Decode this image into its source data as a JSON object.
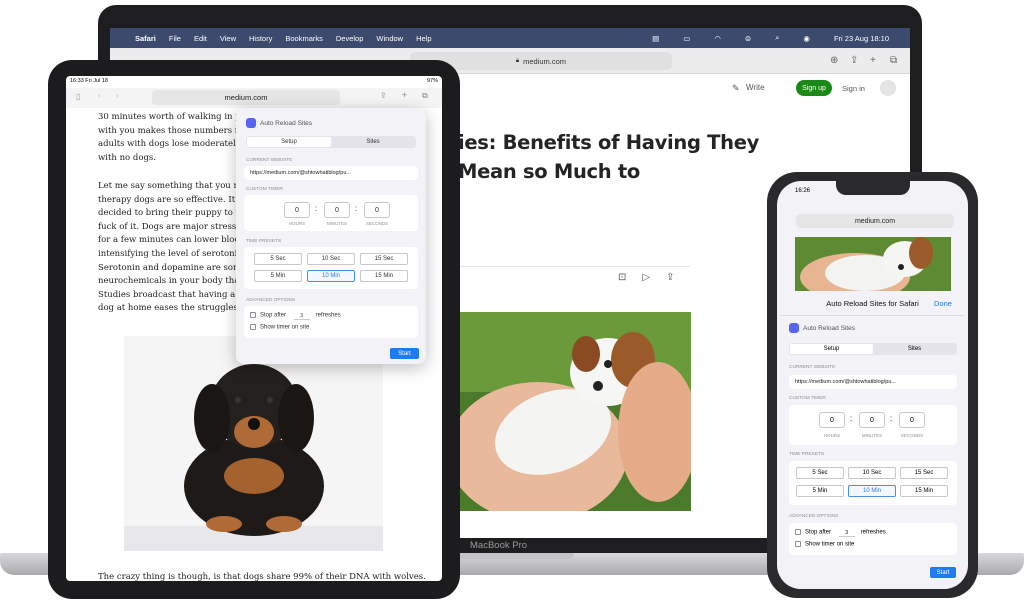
{
  "mac": {
    "menu": {
      "apple": "",
      "items": [
        "Safari",
        "File",
        "Edit",
        "View",
        "History",
        "Bookmarks",
        "Develop",
        "Window",
        "Help"
      ],
      "datetime": "Fri 23 Aug  18:10"
    },
    "url": "medium.com",
    "medium_bar": {
      "write": "Write",
      "signup": "Sign up",
      "signin": "Sign in"
    },
    "headline": "ies: Benefits of Having They Mean so Much to",
    "brand": "MacBook Pro"
  },
  "ipad": {
    "status": {
      "time": "16:33  Fri Jul 18",
      "battery": "97%"
    },
    "url": "medium.com",
    "paragraph1": [
      "30 minutes worth of walking in pe",
      "with you makes those numbers m",
      "adults with dogs lose moderately 1",
      "with no dogs."
    ],
    "paragraph2": [
      "Let me say something that you mig",
      "therapy dogs are so effective. It's n",
      "decided to bring their puppy to wo",
      "fuck of it. Dogs are major stress re",
      "for a few minutes can lower blood",
      "intensifying the level of serotonin",
      "Serotonin and dopamine are some",
      "neurochemicals in your body that",
      "Studies broadcast that having a dog",
      "dog at home eases the struggles of"
    ],
    "bottom_line": "The crazy thing is though, is that dogs share 99% of their DNA with wolves."
  },
  "extension": {
    "app_name": "Auto Reload Sites",
    "tabs": [
      "Setup",
      "Sites"
    ],
    "current_website_label": "CURRENT WEBSITE",
    "current_url": "https://medium.com/@shtowhatiblog/pu...",
    "custom_timer_label": "CUSTOM TIMER",
    "timer": {
      "hours": "0",
      "minutes": "0",
      "seconds": "0"
    },
    "timer_units": {
      "hours": "HOURS",
      "minutes": "MINUTES",
      "seconds": "SECONDS"
    },
    "presets_label": "TIME PRESETS",
    "presets": [
      "5 Sec",
      "10 Sec",
      "15 Sec",
      "5 Min",
      "10 Min",
      "15 Min"
    ],
    "selected_preset": "10 Min",
    "advanced_label": "ADVANCED OPTIONS",
    "stop_after": "Stop after",
    "stop_count": "3",
    "refreshes": "refreshes",
    "show_timer": "Show timer on site",
    "start": "Start"
  },
  "iphone": {
    "status_time": "16:26",
    "url": "medium.com",
    "sheet_title": "Auto Reload Sites for Safari",
    "done": "Done"
  },
  "colors": {
    "accent": "#1e7cf2",
    "signup_green": "#1a8917",
    "menubar": "#3c4a6e"
  }
}
